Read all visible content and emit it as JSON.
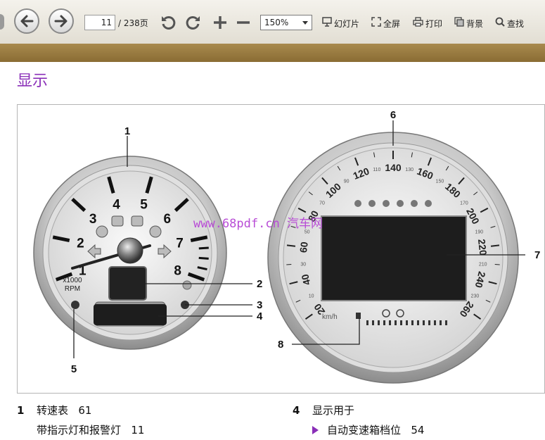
{
  "toolbar": {
    "page_current": "11",
    "page_total": "/ 238页",
    "zoom": "150%",
    "slideshow_label": "幻灯片",
    "fullscreen_label": "全屏",
    "print_label": "打印",
    "background_label": "背景",
    "find_label": "查找"
  },
  "document": {
    "heading": "显示",
    "watermark": "www.68pdf.cn  汽车网",
    "callouts": [
      "1",
      "2",
      "3",
      "4",
      "5",
      "6",
      "7",
      "8"
    ],
    "tacho_numbers": [
      "1",
      "2",
      "3",
      "4",
      "5",
      "6",
      "7",
      "8"
    ],
    "tacho_unit_line1": "x1000",
    "tacho_unit_line2": "RPM",
    "speed_numbers": [
      "20",
      "40",
      "60",
      "80",
      "100",
      "120",
      "140",
      "160",
      "180",
      "200",
      "220",
      "240",
      "260"
    ],
    "speed_unit": "km/h",
    "legend": [
      {
        "num": "1",
        "text": "转速表",
        "page": "61"
      },
      {
        "num": "",
        "text": "带指示灯和报警灯",
        "page": "11"
      },
      {
        "num": "4",
        "text": "显示用于",
        "page": ""
      },
      {
        "num": "",
        "text": "自动变速箱档位",
        "page": "54"
      }
    ]
  },
  "colors": {
    "heading": "#8a2fb8",
    "band": "#9a7b40",
    "watermark": "#b84cd6"
  }
}
